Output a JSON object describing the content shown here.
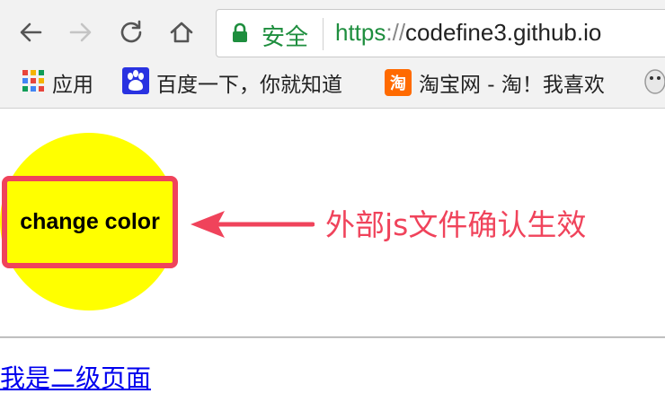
{
  "browser": {
    "secure_label": "安全",
    "url_scheme": "https",
    "url_separator": "://",
    "url_host": "codefine3.github.io",
    "bookmarks": [
      {
        "label": "应用",
        "icon": "apps-grid-icon"
      },
      {
        "label": "百度一下，你就知道",
        "icon": "baidu-paw-icon"
      },
      {
        "label": "淘宝网 - 淘！我喜欢",
        "icon": "taobao-icon"
      }
    ],
    "taobao_icon_char": "淘",
    "colors": {
      "secure": "#1e8e3e",
      "link": "#0000ee"
    }
  },
  "page": {
    "button_label": "change color",
    "annotation": "外部js文件确认生效",
    "link_text": "我是二级页面",
    "colors": {
      "circle": "#ffff00",
      "highlight": "#f0435b"
    }
  }
}
